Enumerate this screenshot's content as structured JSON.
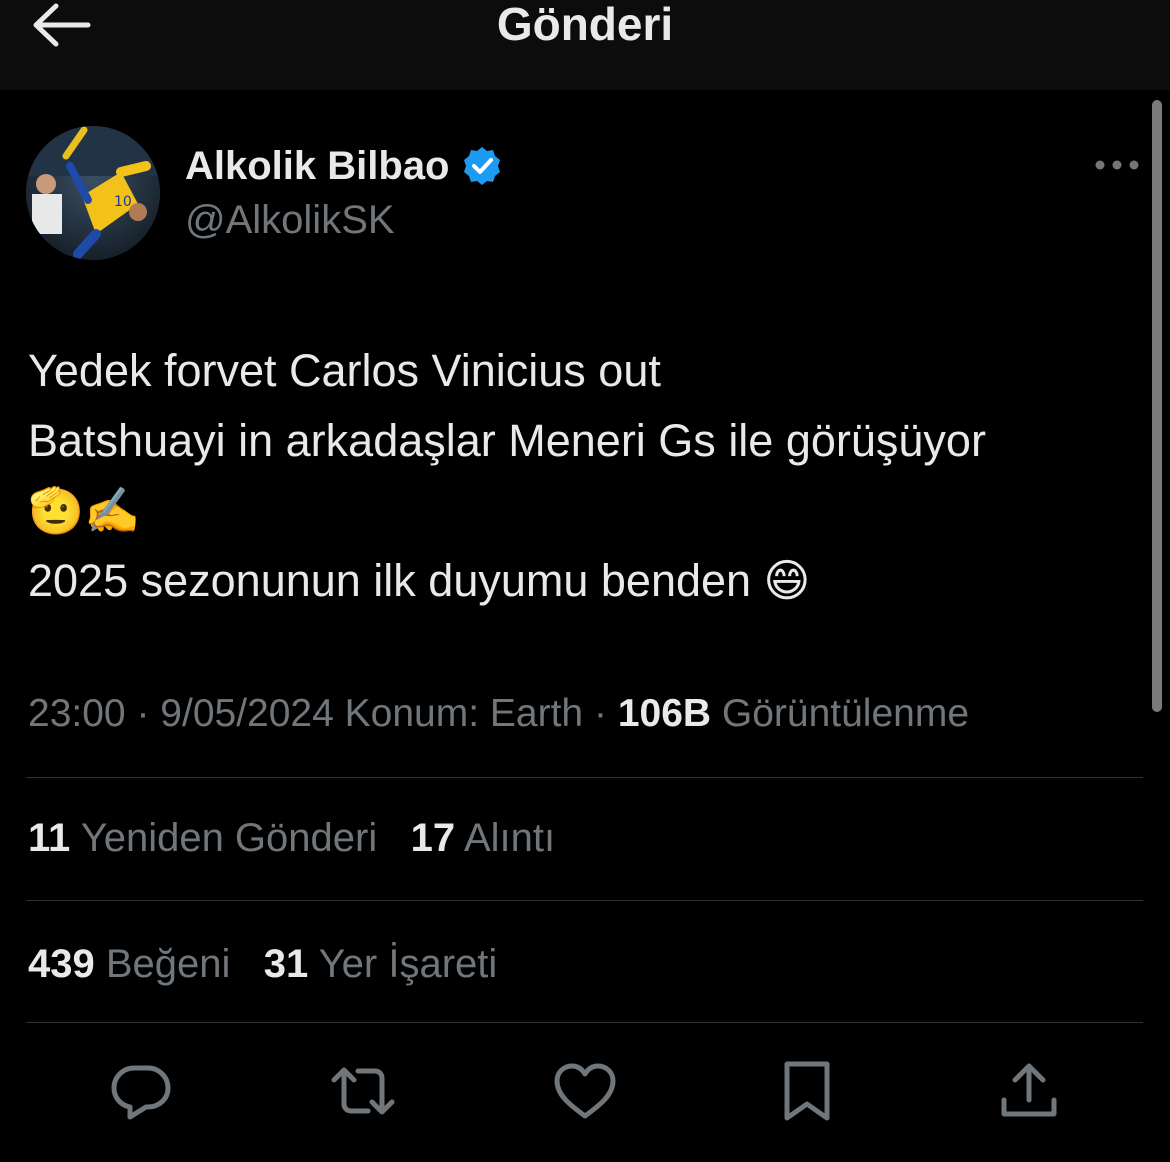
{
  "header": {
    "title": "Gönderi",
    "back_icon": "arrow-left-icon"
  },
  "author": {
    "display_name": "Alkolik Bilbao",
    "handle": "@AlkolikSK",
    "verified_icon": "verified-badge-icon",
    "verified_color": "#1d9bf0"
  },
  "tweet": {
    "lines": [
      "Yedek forvet Carlos Vinicius out",
      "Batshuayi in arkadaşlar Meneri Gs ile görüşüyor",
      "🫡✍️",
      "2025 sezonunun ilk duyumu benden 😄"
    ]
  },
  "meta": {
    "time": "23:00",
    "separator": "·",
    "date": "9/05/2024",
    "location": "Konum: Earth",
    "views_count": "106B",
    "views_label": "Görüntülenme"
  },
  "stats": {
    "reposts_count": "11",
    "reposts_label": "Yeniden Gönderi",
    "quotes_count": "17",
    "quotes_label": "Alıntı",
    "likes_count": "439",
    "likes_label": "Beğeni",
    "bookmarks_count": "31",
    "bookmarks_label": "Yer İşareti"
  },
  "actions": [
    "reply-icon",
    "repost-icon",
    "like-icon",
    "bookmark-icon",
    "share-icon"
  ],
  "colors": {
    "background": "#000000",
    "text": "#e7e9ea",
    "secondary": "#71767b",
    "divider": "#2f3336"
  }
}
